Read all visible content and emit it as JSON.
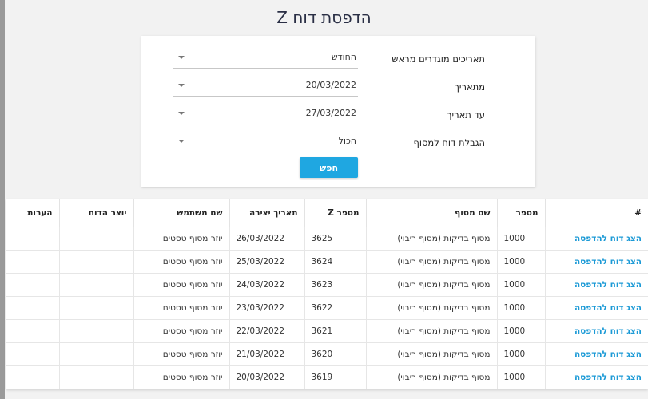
{
  "title": "הדפסת דוח Z",
  "filters": [
    {
      "label": "תאריכים מוגדרים מראש",
      "value": "החודש"
    },
    {
      "label": "מתאריך",
      "value": "20/03/2022"
    },
    {
      "label": "עד תאריך",
      "value": "27/03/2022"
    },
    {
      "label": "הגבלת דוח למסוף",
      "value": "הכול"
    }
  ],
  "search_label": "חפש",
  "table": {
    "headers": [
      "#",
      "מספר",
      "שם מסוף",
      "מספר Z",
      "תאריך יצירה",
      "שם משתמש",
      "יוצר הדוח",
      "הערות"
    ],
    "rows": [
      {
        "action": "הצג דוח להדפסה",
        "number": "1000",
        "terminal": "מסוף בדיקות (מסוף ריבוי)",
        "z": "3625",
        "date": "26/03/2022",
        "user": "יוזר מסוף טסטים",
        "creator": "",
        "notes": ""
      },
      {
        "action": "הצג דוח להדפסה",
        "number": "1000",
        "terminal": "מסוף בדיקות (מסוף ריבוי)",
        "z": "3624",
        "date": "25/03/2022",
        "user": "יוזר מסוף טסטים",
        "creator": "",
        "notes": ""
      },
      {
        "action": "הצג דוח להדפסה",
        "number": "1000",
        "terminal": "מסוף בדיקות (מסוף ריבוי)",
        "z": "3623",
        "date": "24/03/2022",
        "user": "יוזר מסוף טסטים",
        "creator": "",
        "notes": ""
      },
      {
        "action": "הצג דוח להדפסה",
        "number": "1000",
        "terminal": "מסוף בדיקות (מסוף ריבוי)",
        "z": "3622",
        "date": "23/03/2022",
        "user": "יוזר מסוף טסטים",
        "creator": "",
        "notes": ""
      },
      {
        "action": "הצג דוח להדפסה",
        "number": "1000",
        "terminal": "מסוף בדיקות (מסוף ריבוי)",
        "z": "3621",
        "date": "22/03/2022",
        "user": "יוזר מסוף טסטים",
        "creator": "",
        "notes": ""
      },
      {
        "action": "הצג דוח להדפסה",
        "number": "1000",
        "terminal": "מסוף בדיקות (מסוף ריבוי)",
        "z": "3620",
        "date": "21/03/2022",
        "user": "יוזר מסוף טסטים",
        "creator": "",
        "notes": ""
      },
      {
        "action": "הצג דוח להדפסה",
        "number": "1000",
        "terminal": "מסוף בדיקות (מסוף ריבוי)",
        "z": "3619",
        "date": "20/03/2022",
        "user": "יוזר מסוף טסטים",
        "creator": "",
        "notes": ""
      }
    ]
  }
}
